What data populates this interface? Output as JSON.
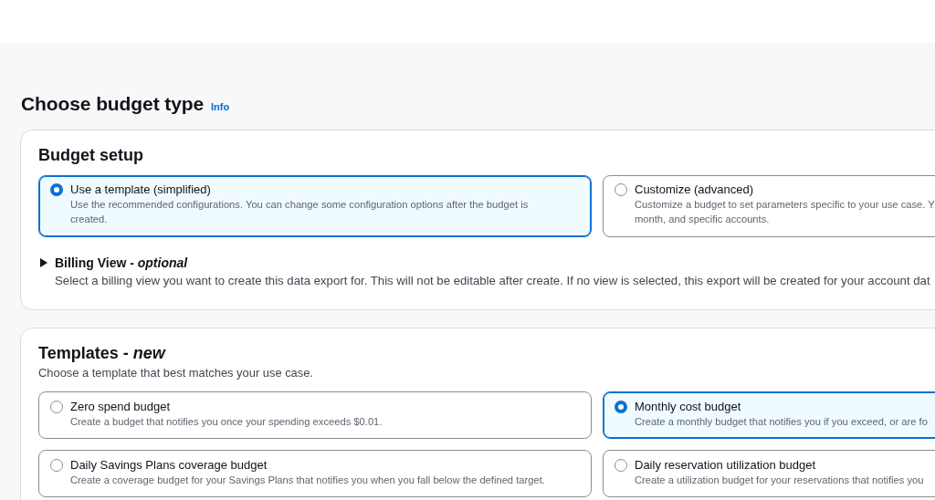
{
  "page": {
    "title": "Choose budget type",
    "info_link": "Info"
  },
  "budget_setup": {
    "title": "Budget setup",
    "options": [
      {
        "label": "Use a template (simplified)",
        "description_lines": [
          "Use the recommended configurations. You can change some configuration options after the budget is",
          "created."
        ],
        "selected": true
      },
      {
        "label": "Customize (advanced)",
        "description_lines": [
          "Customize a budget to set parameters specific to your use case. Y",
          "month, and specific accounts."
        ],
        "selected": false
      }
    ],
    "billing_view": {
      "title": "Billing View - *optional*",
      "expanded": false,
      "description": "Select a billing view you want to create this data export for. This will not be editable after create. If no view is selected, this export will be created for your account dat"
    }
  },
  "templates": {
    "title": "Templates - *new*",
    "description": "Choose a template that best matches your use case.",
    "options": [
      {
        "label": "Zero spend budget",
        "description": "Create a budget that notifies you once your spending exceeds $0.01.",
        "selected": false
      },
      {
        "label": "Monthly cost budget",
        "description": "Create a monthly budget that notifies you if you exceed, or are fo",
        "selected": true
      },
      {
        "label": "Daily Savings Plans coverage budget",
        "description": "Create a coverage budget for your Savings Plans that notifies you when you fall below the defined target.",
        "selected": false
      },
      {
        "label": "Daily reservation utilization budget",
        "description": "Create a utilization budget for your reservations that notifies you",
        "selected": false
      }
    ]
  }
}
